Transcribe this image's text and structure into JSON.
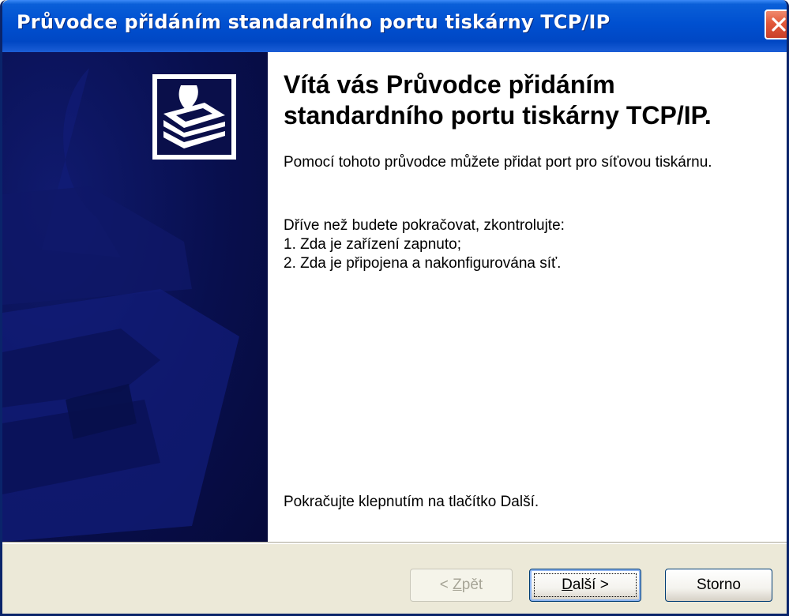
{
  "window": {
    "title": "Průvodce přidáním standardního portu tiskárny TCP/IP",
    "close_icon": "close-icon"
  },
  "sidebar": {
    "logo_icon": "printer-port-icon",
    "background_color": "#080f4e"
  },
  "main": {
    "heading": "Vítá vás Průvodce přidáním standardního portu tiskárny TCP/IP.",
    "intro": "Pomocí tohoto průvodce můžete přidat port pro síťovou tiskárnu.",
    "check_intro": "Dříve než budete pokračovat, zkontrolujte:",
    "checks": [
      "1. Zda je zařízení zapnuto;",
      "2. Zda je připojena a nakonfigurována síť."
    ],
    "continue_hint": "Pokračujte klepnutím na tlačítko Další."
  },
  "footer": {
    "back_label_pre": "< ",
    "back_label_key": "Z",
    "back_label_post": "pět",
    "next_label_key": "D",
    "next_label_post": "alší >",
    "cancel_label": "Storno"
  },
  "colors": {
    "title_bar": "#0050d0",
    "close_button": "#e2583a",
    "sidebar": "#080f4e",
    "dialog_face": "#ece9d8"
  }
}
